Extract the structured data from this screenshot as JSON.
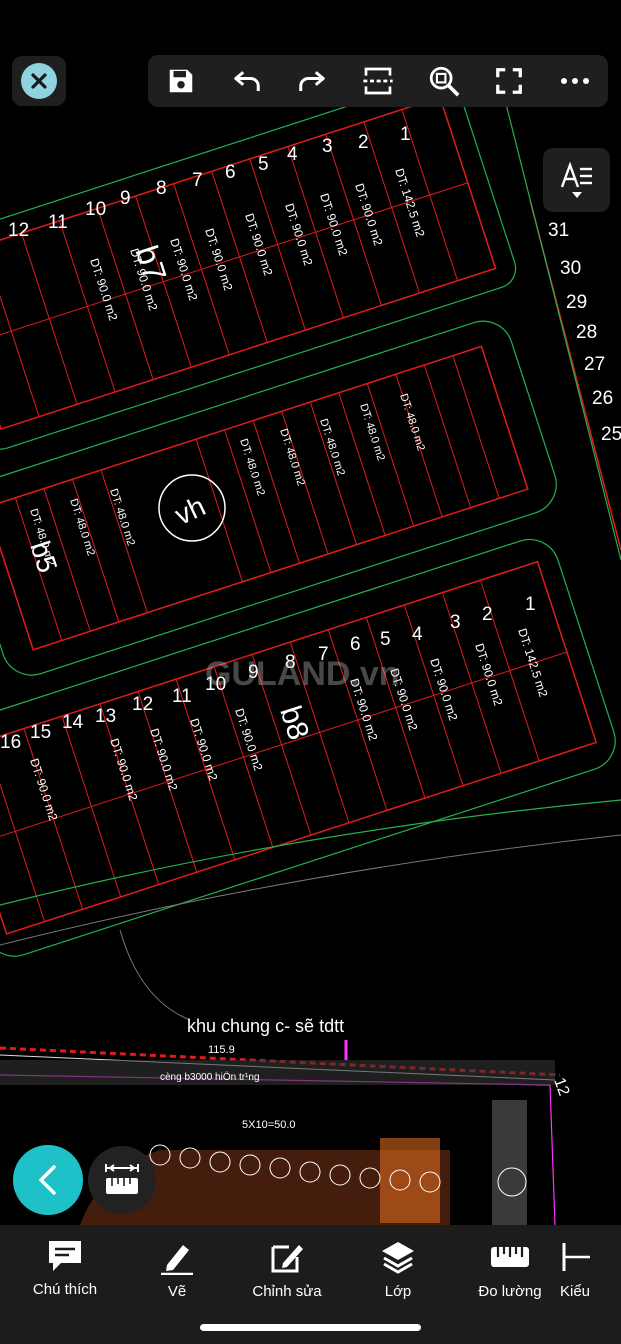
{
  "drawing": {
    "block_labels": [
      "b7",
      "b5",
      "b8",
      "vh"
    ],
    "lot_area_text": "DT: 90.0 m2",
    "lot_area_small_text": "DT: 48.0 m2",
    "lot_area_corner_text": "DT: 142.5 m2",
    "area_title": "khu chung c- sẽ tdtt",
    "dimension_text": "115.9",
    "road_text": "cèng b3000 hiÖn tr¹ng",
    "parking_text": "5X10=50.0",
    "watermark": "GULAND.vn"
  },
  "toolbar": {
    "icons": [
      "save-icon",
      "undo-icon",
      "redo-icon",
      "fit-width-icon",
      "zoom-extents-icon",
      "fullscreen-icon",
      "more-icon"
    ]
  },
  "bottom_nav": {
    "items": [
      {
        "label": "Chú thích",
        "icon": "comment-icon"
      },
      {
        "label": "Vẽ",
        "icon": "pencil-icon"
      },
      {
        "label": "Chỉnh sửa",
        "icon": "edit-icon"
      },
      {
        "label": "Lớp",
        "icon": "layers-icon"
      },
      {
        "label": "Đo lường",
        "icon": "ruler-icon"
      },
      {
        "label": "Kiểu",
        "icon": "dimension-style-icon"
      }
    ]
  },
  "colors": {
    "accent": "#1fc1c8",
    "close_bg": "#8fd3e0",
    "lot_border": "#e21b1b",
    "road_green": "#22b24c"
  }
}
